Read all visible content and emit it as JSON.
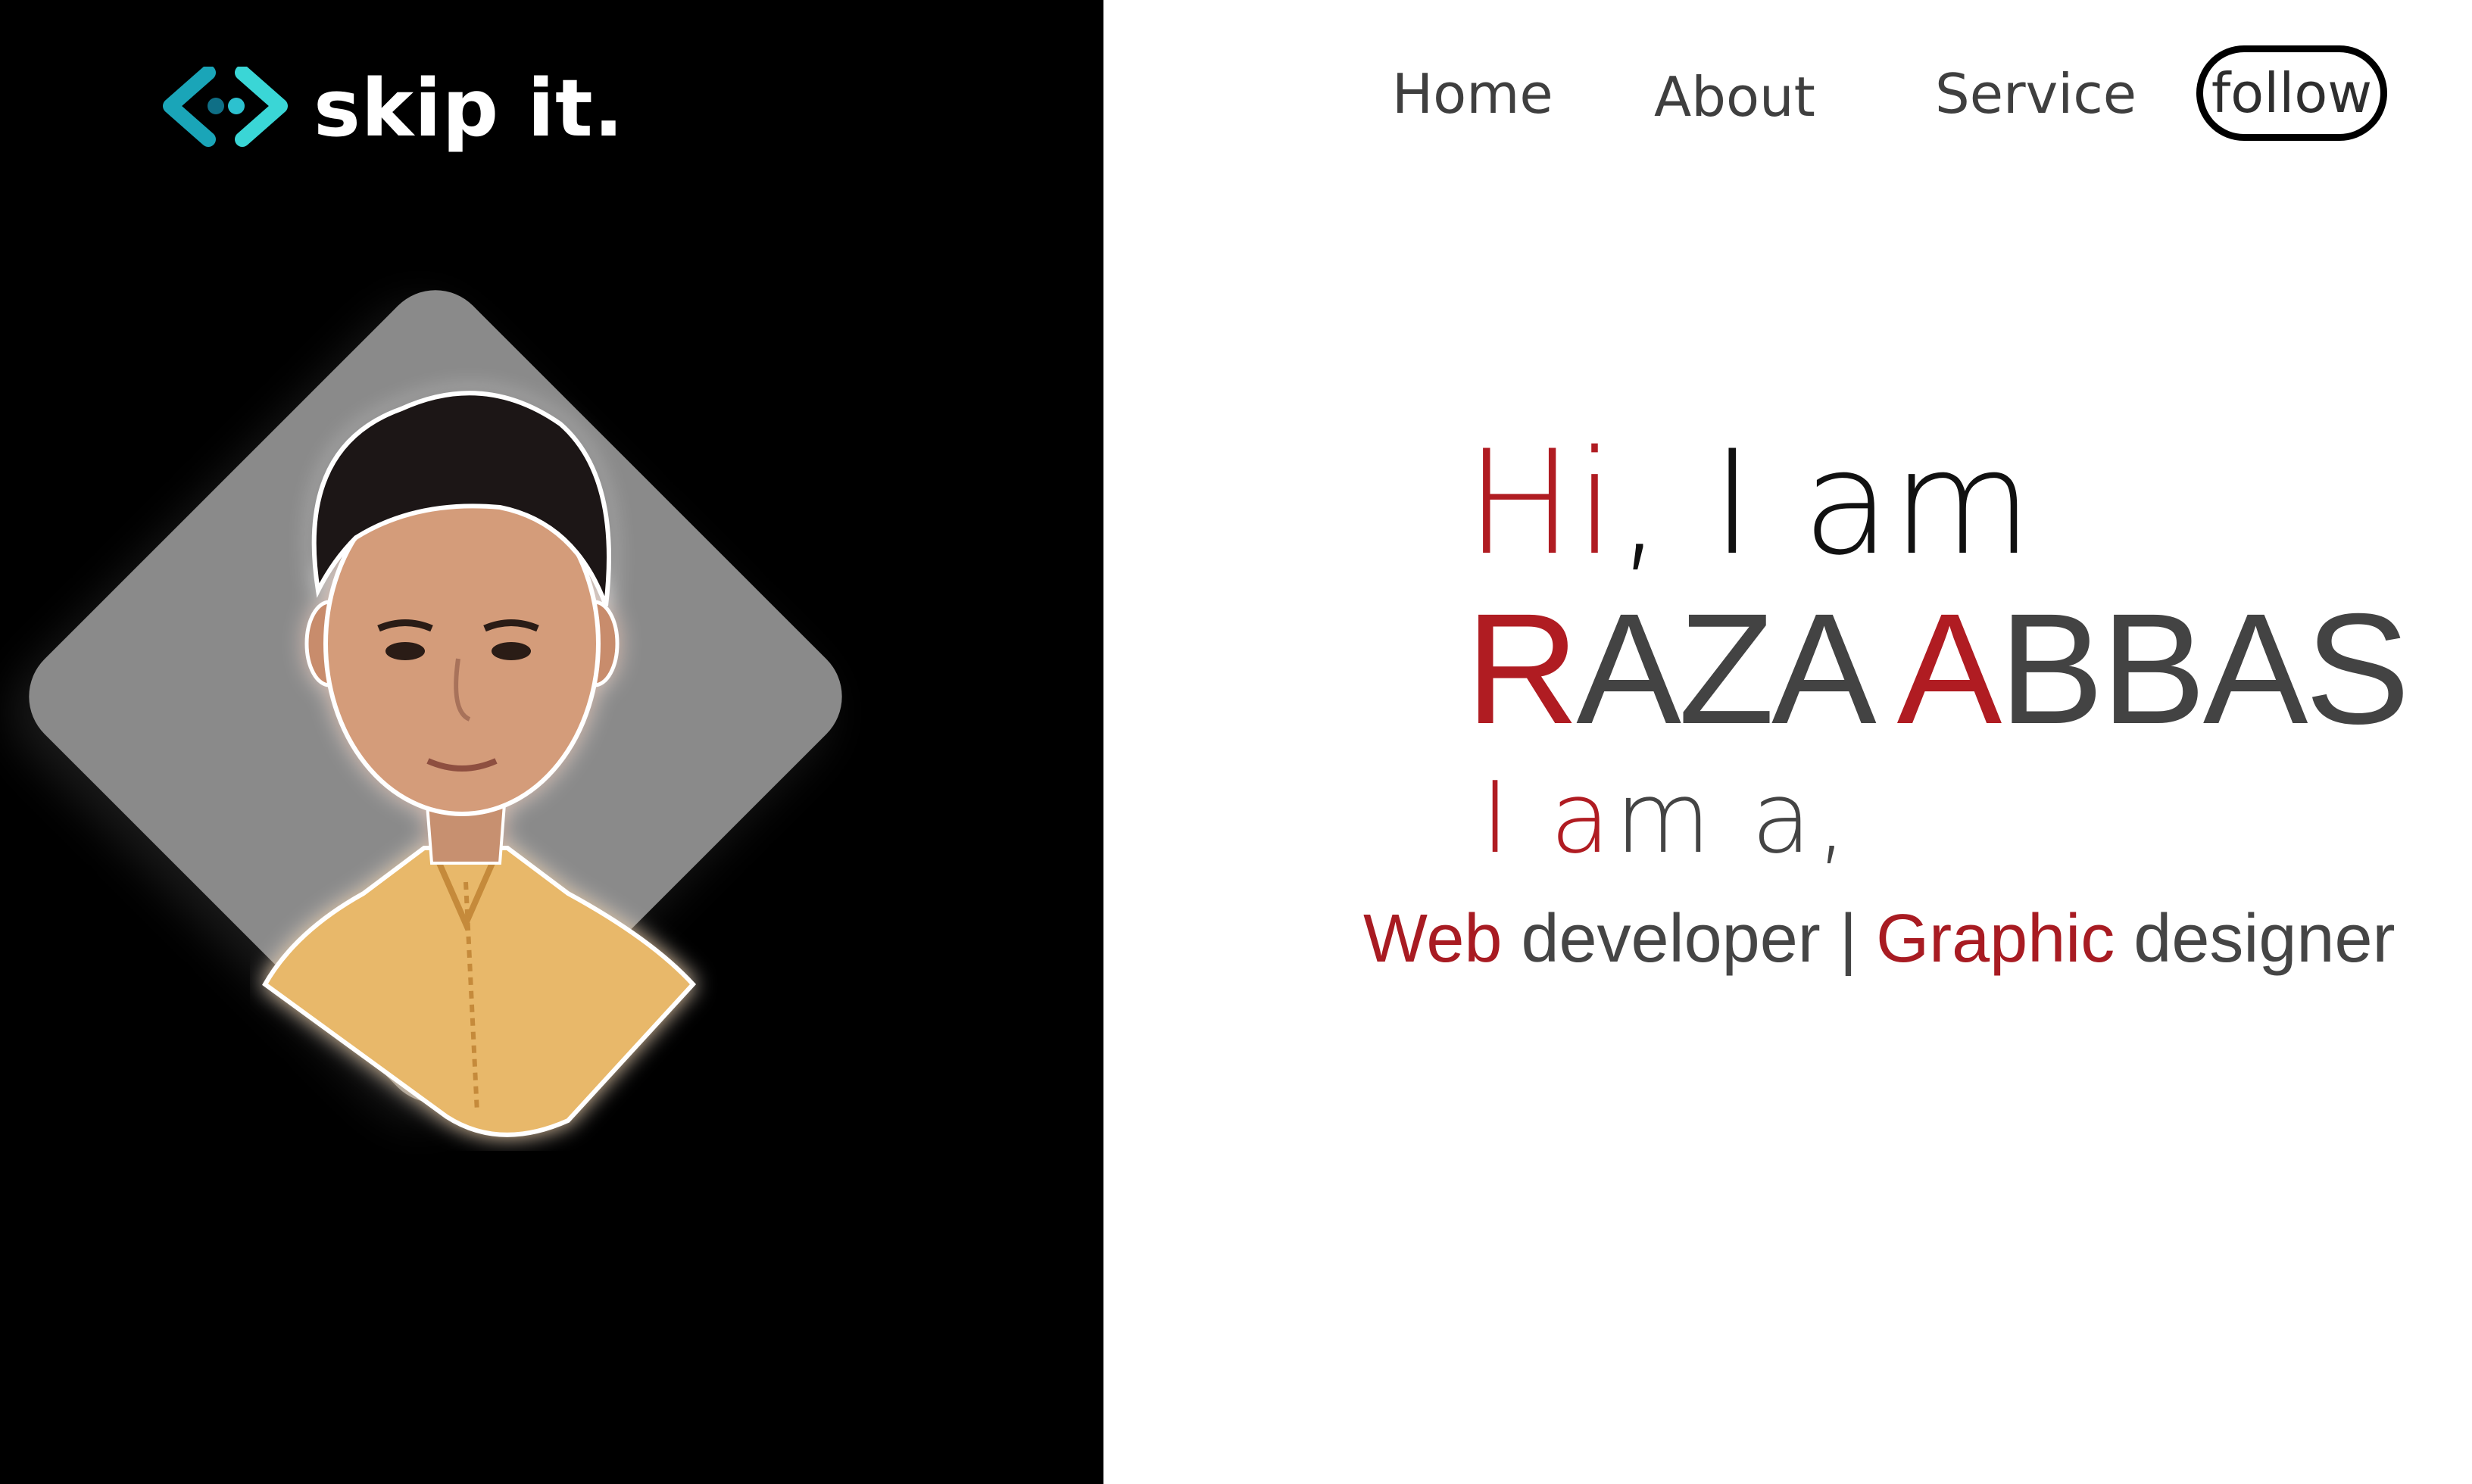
{
  "brand": {
    "name": "skip it.",
    "colors": {
      "mark_light": "#3ad6d6",
      "mark_dark": "#0f6f86"
    }
  },
  "nav": {
    "items": [
      {
        "label": "Home"
      },
      {
        "label": "About"
      },
      {
        "label": "Service"
      }
    ],
    "follow_label": "follow"
  },
  "hero": {
    "greeting": {
      "hi": "Hi",
      "rest": ", I am"
    },
    "name": {
      "first_initial": "R",
      "first_rest": "AZA ",
      "last_initial": "A",
      "last_rest": "BBAS"
    },
    "intro": {
      "i": "I ",
      "am_a": "a",
      "am_rest": "m a,"
    },
    "roles": {
      "role1_highlight": "Web",
      "role1_rest": " developer | ",
      "role2_highlight": "Graphic",
      "role2_rest": " designer"
    }
  },
  "colors": {
    "accent_red": "#b01c22",
    "text_dark": "#434343",
    "panel_black": "#000000",
    "diamond_gray": "#8a8a8a"
  },
  "icons": {
    "logo": "code-arrows-icon",
    "portrait": "person-photo"
  }
}
